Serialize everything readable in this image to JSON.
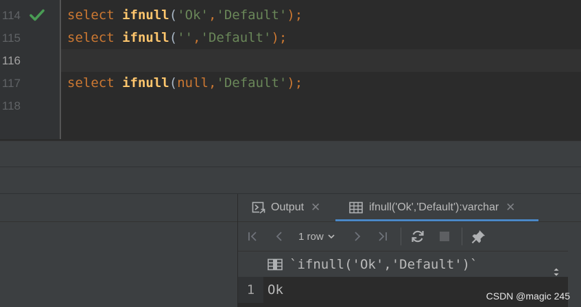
{
  "editor": {
    "lines": [
      {
        "number": "114",
        "tokens": {
          "kw": "select",
          "fn": "ifnull",
          "open": "(",
          "arg1": "'Ok'",
          "comma": ",",
          "arg2": "'Default'",
          "close": ");"
        }
      },
      {
        "number": "115",
        "tokens": {
          "kw": "select",
          "fn": "ifnull",
          "open": "(",
          "arg1": "''",
          "comma": ",",
          "arg2": "'Default'",
          "close": ");"
        }
      },
      {
        "number": "116"
      },
      {
        "number": "117",
        "tokens": {
          "kw": "select",
          "fn": "ifnull",
          "open": "(",
          "arg1": "null",
          "comma": ",",
          "arg2": "'Default'",
          "close": ");"
        }
      },
      {
        "number": "118"
      }
    ]
  },
  "results": {
    "tabs": [
      {
        "label": "Output",
        "close": "✕"
      },
      {
        "label": "ifnull('Ok','Default'):varchar",
        "close": "✕"
      }
    ],
    "toolbar": {
      "row_count": "1 row"
    },
    "column": {
      "name": "`ifnull('Ok','Default')`"
    },
    "rows": [
      {
        "number": "1",
        "value": "Ok"
      }
    ]
  },
  "watermark": "CSDN @magic 245",
  "icons": [
    "check-icon",
    "output-icon",
    "table-icon",
    "first-page-icon",
    "prev-icon",
    "chevron-down-icon",
    "next-icon",
    "last-page-icon",
    "refresh-icon",
    "stop-icon",
    "pin-icon",
    "column-icon",
    "sort-icon"
  ],
  "colors": {
    "keyword": "#cc7832",
    "function": "#ffc66d",
    "string": "#6a8759",
    "success": "#499c54",
    "tab_accent": "#4a88c7"
  }
}
